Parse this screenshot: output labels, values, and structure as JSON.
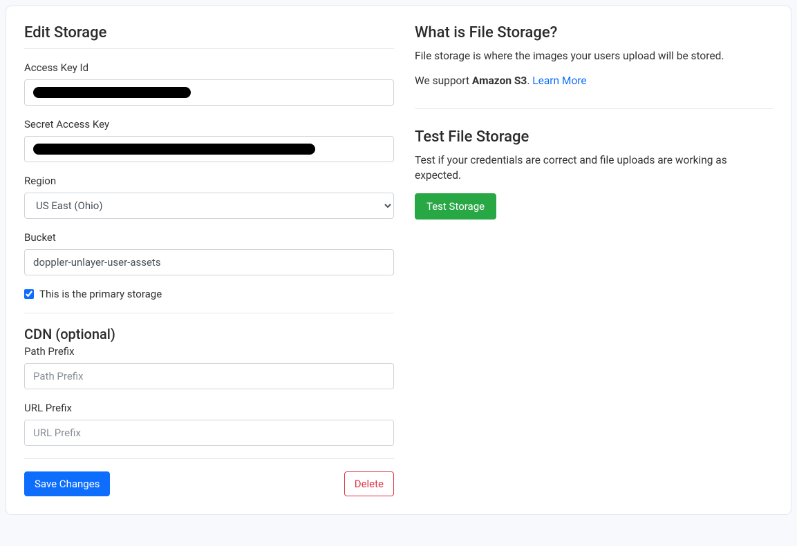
{
  "left": {
    "title": "Edit Storage",
    "fields": {
      "access_key_id": {
        "label": "Access Key Id",
        "value": ""
      },
      "secret_access_key": {
        "label": "Secret Access Key",
        "value": ""
      },
      "region": {
        "label": "Region",
        "selected": "US East (Ohio)"
      },
      "bucket": {
        "label": "Bucket",
        "value": "doppler-unlayer-user-assets"
      }
    },
    "primary_checkbox": {
      "label": "This is the primary storage",
      "checked": true
    },
    "cdn": {
      "title": "CDN (optional)",
      "path_prefix": {
        "label": "Path Prefix",
        "placeholder": "Path Prefix",
        "value": ""
      },
      "url_prefix": {
        "label": "URL Prefix",
        "placeholder": "URL Prefix",
        "value": ""
      }
    },
    "actions": {
      "save": "Save Changes",
      "delete": "Delete"
    }
  },
  "right": {
    "what": {
      "title": "What is File Storage?",
      "desc": "File storage is where the images your users upload will be stored.",
      "support_prefix": "We support ",
      "support_strong": "Amazon S3",
      "support_suffix": ". ",
      "learn_more": "Learn More"
    },
    "test": {
      "title": "Test File Storage",
      "desc": "Test if your credentials are correct and file uploads are working as expected.",
      "button": "Test Storage"
    }
  }
}
